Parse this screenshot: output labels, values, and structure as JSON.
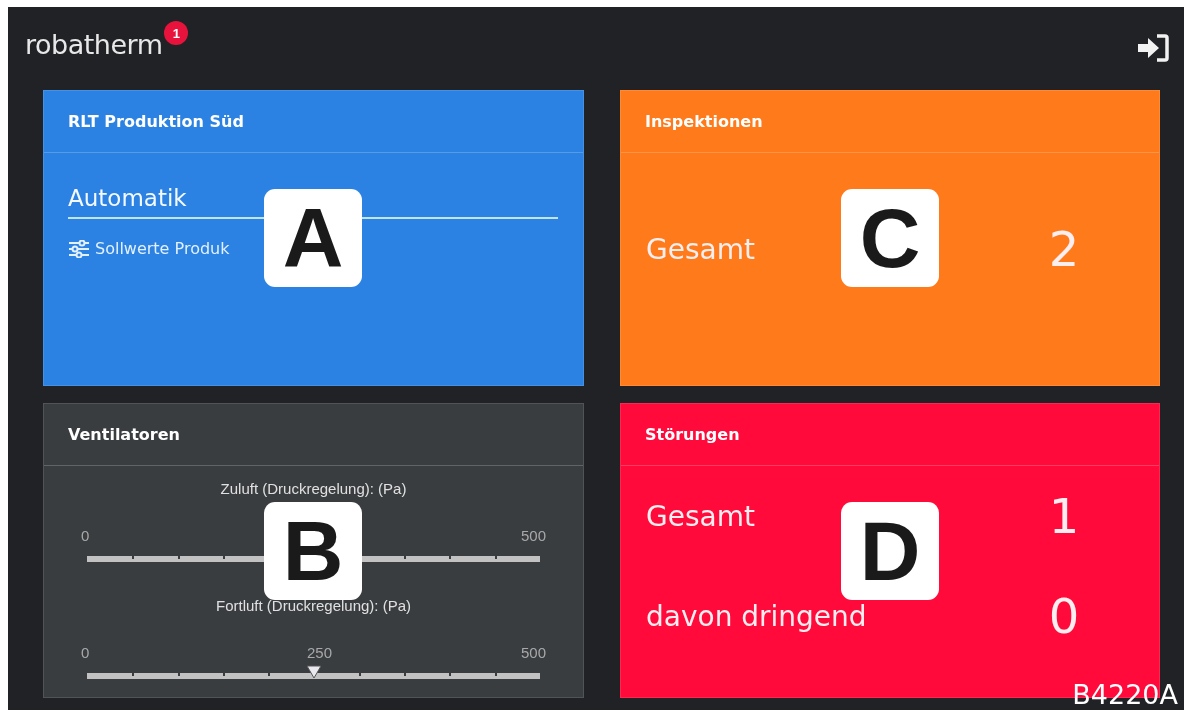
{
  "header": {
    "brand": "robatherm",
    "notification_count": "1"
  },
  "cards": [
    {
      "kind": "status",
      "title": "RLT Produktion Süd",
      "color": "#2b82e3",
      "mode": "Automatik",
      "link": "Sollwerte Produk",
      "callout": "A"
    },
    {
      "kind": "counts",
      "title": "Inspektionen",
      "color": "#ff7a1a",
      "rows": [
        {
          "label": "Gesamt",
          "value": "2"
        }
      ],
      "callout": "C"
    },
    {
      "kind": "sliders",
      "title": "Ventilatoren",
      "color": "#3a3d40",
      "sliders": [
        {
          "label": "Zuluft (Druckregelung): (Pa)",
          "min": "0",
          "max": "500"
        },
        {
          "label": "Fortluft (Druckregelung): (Pa)",
          "min": "0",
          "max": "500",
          "value": "250",
          "level": 0.5
        }
      ],
      "callout": "B"
    },
    {
      "kind": "counts",
      "title": "Störungen",
      "color": "#ff0a3a",
      "rows": [
        {
          "label": "Gesamt",
          "value": "1"
        },
        {
          "label": "davon dringend",
          "value": "0"
        }
      ],
      "callout": "D"
    }
  ],
  "figure_code": "B4220A"
}
